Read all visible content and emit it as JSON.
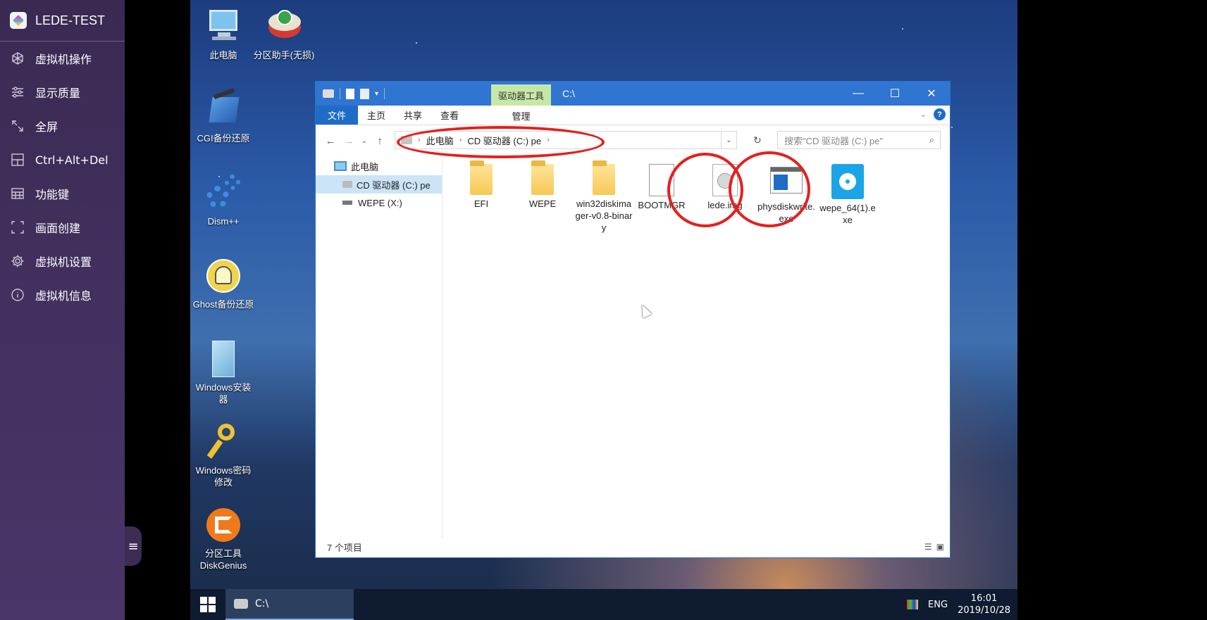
{
  "sidebar": {
    "title": "LEDE-TEST",
    "items": [
      {
        "label": "虚拟机操作",
        "icon": "vm-cube-icon"
      },
      {
        "label": "显示质量",
        "icon": "sliders-icon"
      },
      {
        "label": "全屏",
        "icon": "fullscreen-icon"
      },
      {
        "label": "Ctrl+Alt+Del",
        "icon": "keyboard-combo-icon"
      },
      {
        "label": "功能键",
        "icon": "function-keys-icon"
      },
      {
        "label": "画面创建",
        "icon": "screenshot-icon"
      },
      {
        "label": "虚拟机设置",
        "icon": "gear-icon"
      },
      {
        "label": "虚拟机信息",
        "icon": "info-icon"
      }
    ],
    "handle_icon": "≡"
  },
  "desktop": {
    "icons": [
      {
        "label": "此电脑"
      },
      {
        "label": "分区助手(无损)"
      },
      {
        "label": "CGI备份还原"
      },
      {
        "label": "Dism++"
      },
      {
        "label": "Ghost备份还原"
      },
      {
        "label": "Windows安装器"
      },
      {
        "label": "Windows密码修改"
      },
      {
        "label": "分区工具DiskGenius"
      }
    ]
  },
  "explorer": {
    "title": "C:\\",
    "context_tab": "驱动器工具",
    "ribbon_tabs": [
      "文件",
      "主页",
      "共享",
      "查看",
      "管理"
    ],
    "help": "?",
    "address": {
      "segments": [
        "此电脑",
        "CD 驱动器 (C:) pe"
      ]
    },
    "search_placeholder": "搜索\"CD 驱动器 (C:) pe\"",
    "nav": [
      {
        "label": "此电脑"
      },
      {
        "label": "CD 驱动器 (C:) pe"
      },
      {
        "label": "WEPE (X:)"
      }
    ],
    "files": [
      {
        "label": "EFI",
        "type": "folder"
      },
      {
        "label": "WEPE",
        "type": "folder"
      },
      {
        "label": "win32diskimager-v0.8-binary",
        "type": "folder"
      },
      {
        "label": "BOOTMGR",
        "type": "file"
      },
      {
        "label": "lede.img",
        "type": "disc-image"
      },
      {
        "label": "physdiskwrite.exe",
        "type": "exe"
      },
      {
        "label": "wepe_64(1).exe",
        "type": "installer"
      }
    ],
    "status": "7 个项目"
  },
  "taskbar": {
    "task_label": "C:\\",
    "lang": "ENG",
    "time": "16:01",
    "date": "2019/10/28"
  },
  "colors": {
    "sidebar_bg": "#43305f",
    "title_blue": "#2f75d1",
    "context_green": "#c6e8a6",
    "annotation_red": "#e4201e"
  }
}
